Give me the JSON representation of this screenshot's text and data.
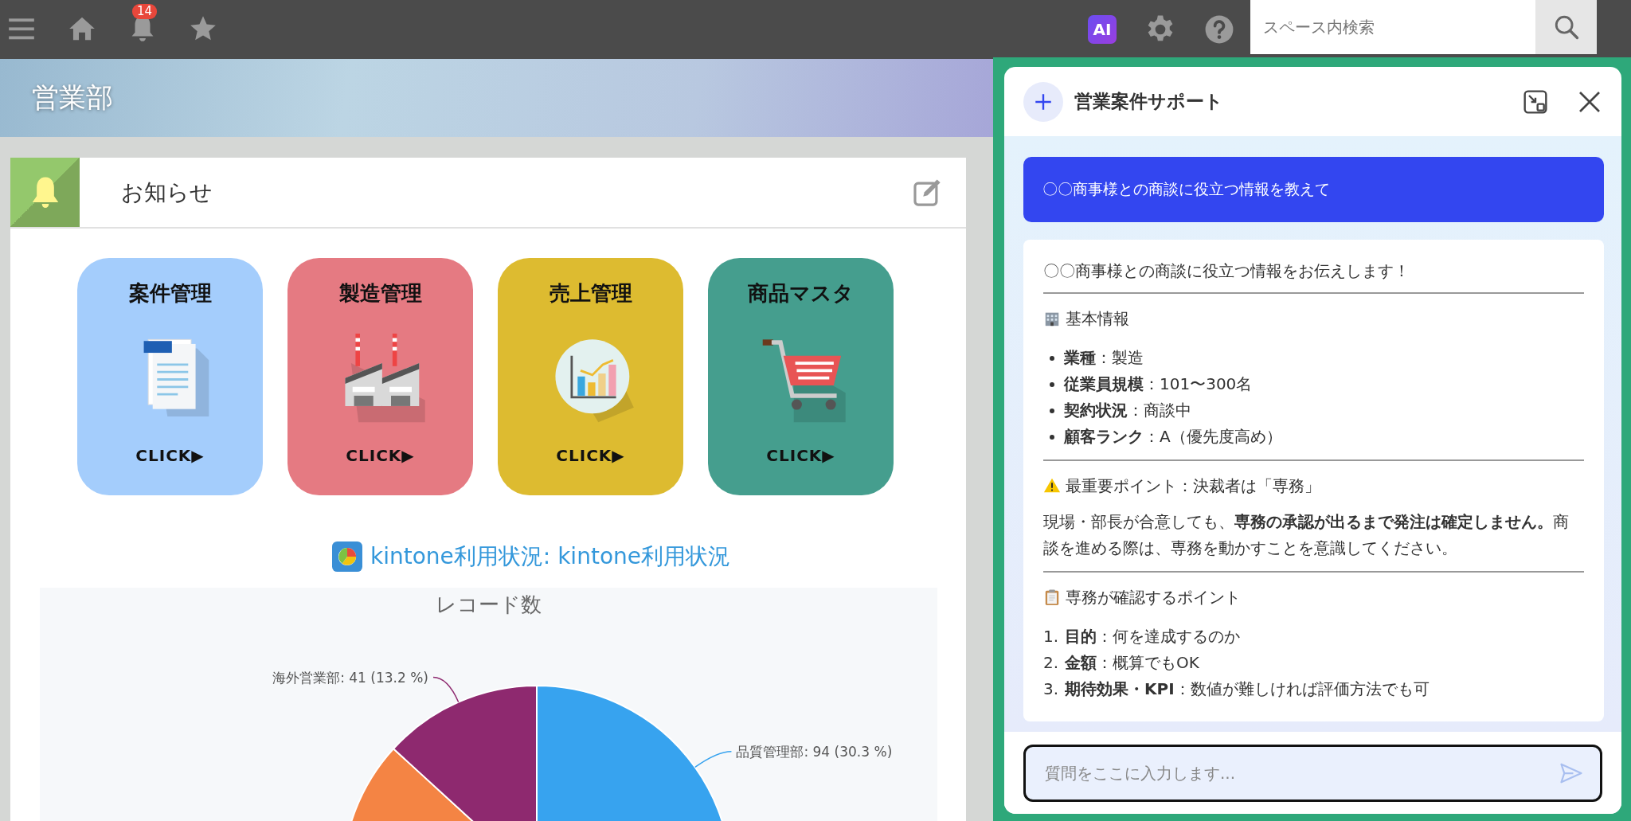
{
  "topbar": {
    "notification_count": "14",
    "ai_label": "AI",
    "search": {
      "placeholder": "スペース内検索"
    }
  },
  "space": {
    "title": "営業部"
  },
  "notice": {
    "title": "お知らせ",
    "tiles": [
      {
        "title": "案件管理",
        "action": "CLICK▶",
        "color": "#a4cdfc",
        "kind": "document"
      },
      {
        "title": "製造管理",
        "action": "CLICK▶",
        "color": "#e57a82",
        "kind": "factory"
      },
      {
        "title": "売上管理",
        "action": "CLICK▶",
        "color": "#ddbb30",
        "kind": "chart"
      },
      {
        "title": "商品マスタ",
        "action": "CLICK▶",
        "color": "#459e8e",
        "kind": "cart"
      }
    ]
  },
  "report": {
    "link": "kintone利用状況: kintone利用状況",
    "chart_data": {
      "type": "pie",
      "title": "レコード数",
      "values": [
        30.3,
        56.5,
        13.2
      ],
      "colors": [
        "#37a3ef",
        "#f48444",
        "#8e296f"
      ],
      "value_labels": [
        "品質管理部: 94 (30.3 %)",
        null,
        "海外営業部: 41 (13.2 %)"
      ]
    }
  },
  "assistant": {
    "title": "営業案件サポート",
    "messages": [
      {
        "kind": "user",
        "text": "〇〇商事様との商談に役立つ情報を教えて"
      },
      {
        "kind": "answer",
        "blocks": [
          {
            "kind": "text",
            "text": "〇〇商事様との商談に役立つ情報をお伝えします！"
          },
          {
            "kind": "rule"
          },
          {
            "kind": "heading",
            "text": "基本情報"
          },
          {
            "kind": "bullets",
            "items": [
              "**業種**：製造",
              "**従業員規模**：101〜300名",
              "**契約状況**：商談中",
              "**顧客ランク**：A（優先度高め）"
            ]
          },
          {
            "kind": "rule"
          },
          {
            "kind": "heading",
            "text": "最重要ポイント：決裁者は「専務」"
          },
          {
            "kind": "paragraph",
            "text": "現場・部長が合意しても、**専務の承認が出るまで発注は確定しません。**商談を進める際は、専務を動かすことを意識してください。"
          },
          {
            "kind": "rule"
          },
          {
            "kind": "heading",
            "text": "専務が確認するポイント"
          },
          {
            "kind": "numbered",
            "items": [
              {
                "number": "1.",
                "text": "**目的**：何を達成するのか"
              },
              {
                "number": "2.",
                "text": "**金額**：概算でもOK"
              },
              {
                "number": "3.",
                "text": "**期待効果・KPI**：数値が難しければ評価方法でも可"
              }
            ]
          }
        ]
      }
    ],
    "input": {
      "placeholder": "質問をここに入力します..."
    }
  }
}
